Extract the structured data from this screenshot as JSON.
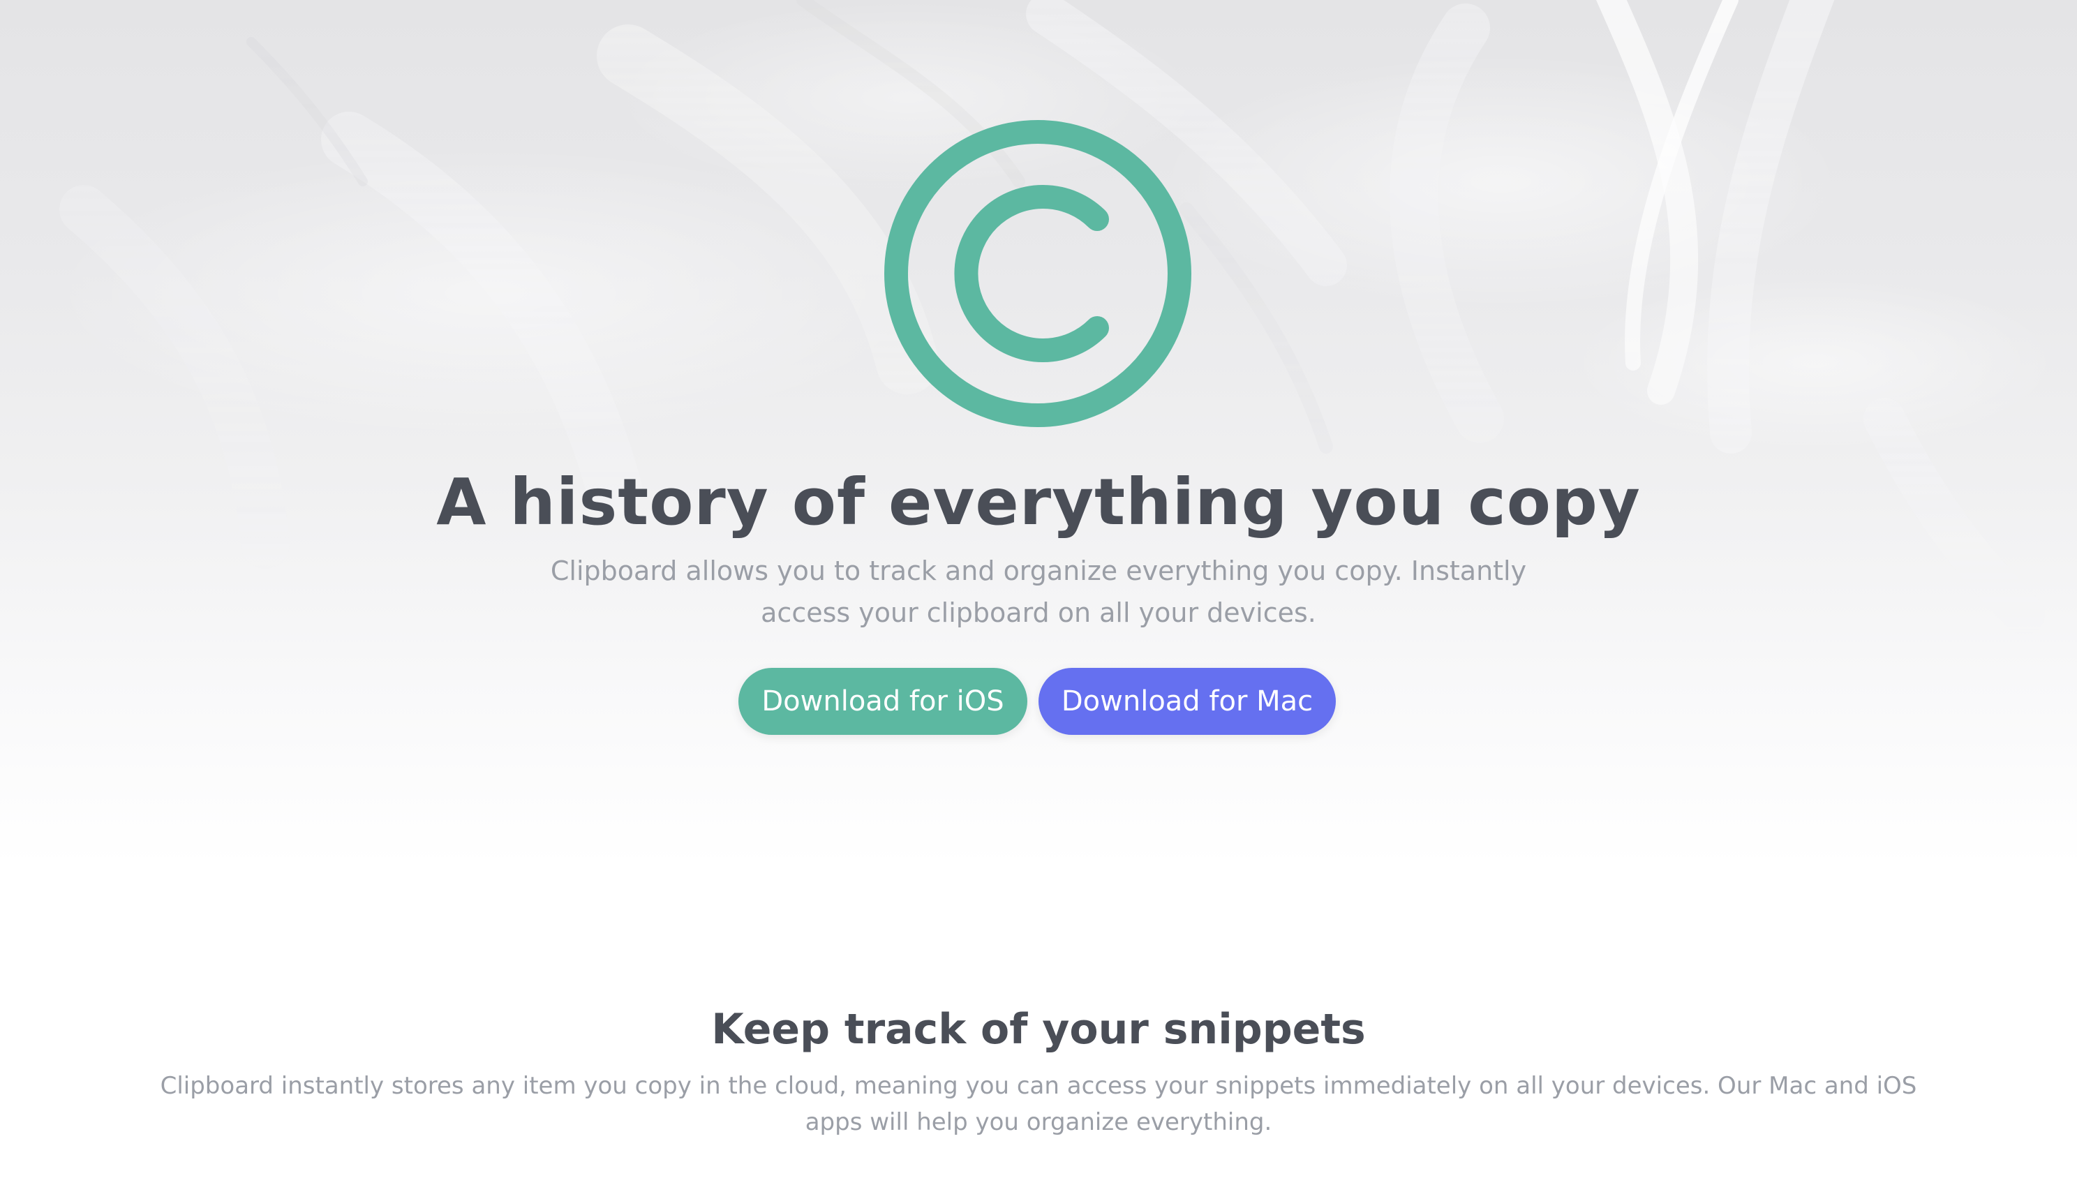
{
  "colors": {
    "brand_green": "#5cb8a1",
    "brand_purple": "#6570f0",
    "heading": "#4a4e57",
    "body_text": "#9a9ea6"
  },
  "hero": {
    "logo_icon": "copyright-c-icon",
    "title": "A history of everything you copy",
    "subtitle": "Clipboard allows you to track and organize everything you copy. Instantly access your clipboard on all your devices.",
    "buttons": {
      "ios_label": "Download for iOS",
      "mac_label": "Download for Mac"
    }
  },
  "features": {
    "title": "Keep track of your snippets",
    "text": "Clipboard instantly stores any item you copy in the cloud, meaning you can access your snippets immediately on all your devices. Our Mac and iOS apps will help you organize everything."
  }
}
